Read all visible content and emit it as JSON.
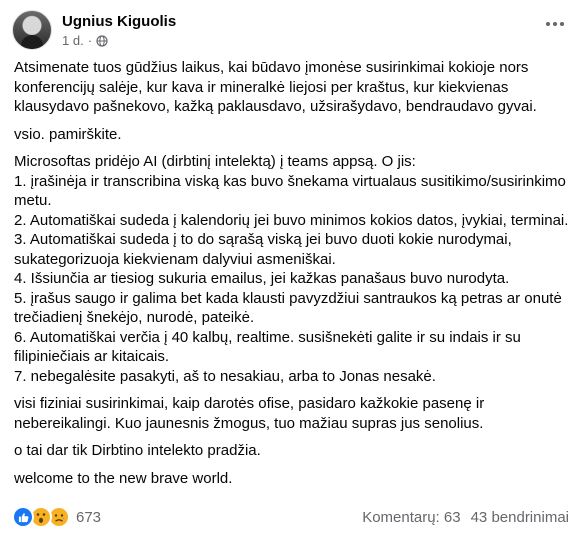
{
  "header": {
    "author": "Ugnius Kiguolis",
    "time": "1 d.",
    "separator": "·"
  },
  "post": {
    "paragraphs": [
      "Atsimenate tuos gūdžius laikus, kai būdavo įmonėse susirinkimai kokioje nors konferencijų salėje, kur kava ir mineralkė liejosi per kraštus, kur kiekvienas klausydavo pašnekovo, kažką paklausdavo, užsirašydavo, bendraudavo gyvai.",
      "vsio. pamirškite."
    ],
    "list_intro": "Microsoftas pridėjo AI (dirbtinį intelektą) į teams appsą. O jis:",
    "list": [
      "1. įrašinėja ir transcribina viską kas buvo šnekama virtualaus susitikimo/susirinkimo metu.",
      "2. Automatiškai sudeda į kalendorių jei buvo minimos kokios datos, įvykiai, terminai.",
      "3. Automatiškai sudeda į to do sąrašą viską jei buvo duoti kokie nurodymai, sukategorizuoja kiekvienam dalyviui asmeniškai.",
      "4. Išsiunčia ar tiesiog sukuria emailus, jei kažkas panašaus buvo nurodyta.",
      "5. įrašus saugo ir galima bet kada klausti pavyzdžiui santraukos ką petras ar onutė trečiadienį šnekėjo, nurodė, pateikė.",
      "6. Automatiškai verčia į 40 kalbų, realtime. susišnekėti galite ir su indais ir su filipiniečiais ar kitaicais.",
      "7. nebegalėsite pasakyti, aš to nesakiau, arba to Jonas nesakė."
    ],
    "after": [
      "visi fiziniai susirinkimai, kaip darotės ofise, pasidaro kažkokie pasenę ir nebereikalingi. Kuo jaunesnis žmogus, tuo mažiau supras jus senolius.",
      "o tai dar tik Dirbtino intelekto pradžia.",
      "welcome to the new brave world."
    ]
  },
  "footer": {
    "reaction_icons": [
      "like-icon",
      "wow-icon",
      "sad-icon"
    ],
    "reaction_count": "673",
    "comments": "Komentarų: 63",
    "shares": "43 bendrinimai"
  },
  "colors": {
    "like": "#1877f2",
    "emoji": "#f7b125",
    "secondary_text": "#65676b"
  }
}
